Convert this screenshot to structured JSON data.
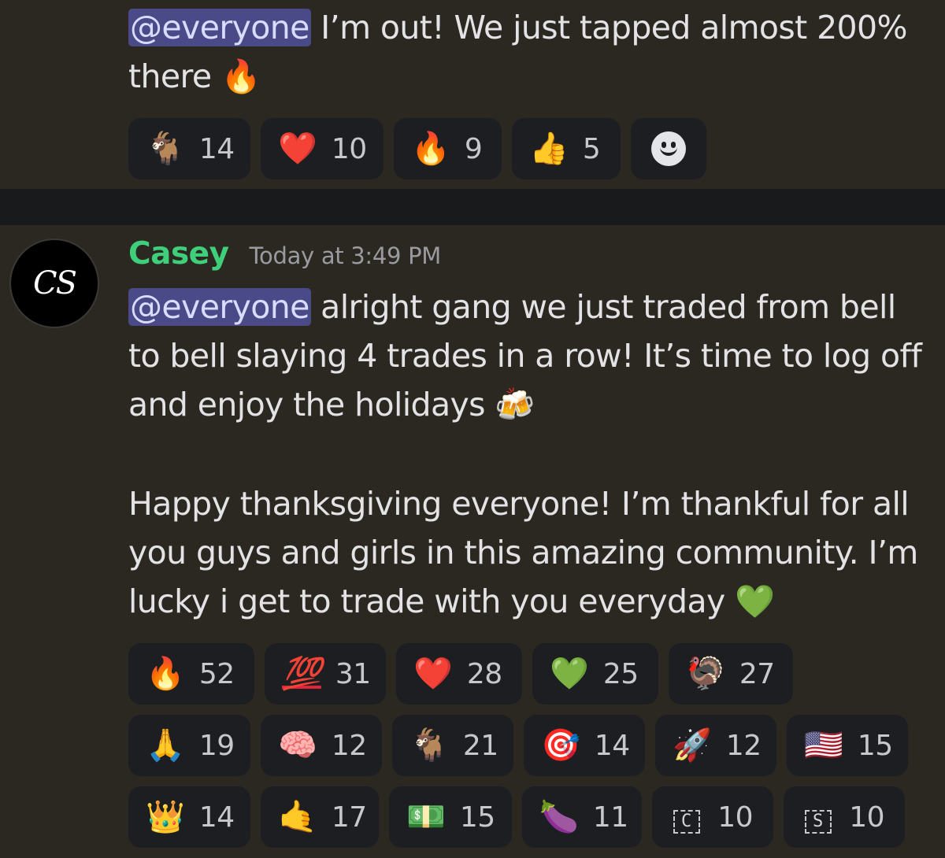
{
  "message1": {
    "mention": "@everyone",
    "text": "I’m out! We just tapped almost 200% there 🔥",
    "reactions": [
      {
        "emoji": "🐐",
        "count": "14"
      },
      {
        "emoji": "❤️",
        "count": "10"
      },
      {
        "emoji": "🔥",
        "count": "9"
      },
      {
        "emoji": "👍",
        "count": "5"
      }
    ]
  },
  "message2": {
    "avatar_initials": "CS",
    "author": "Casey",
    "timestamp": "Today at 3:49 PM",
    "mention": "@everyone",
    "paragraph1": "alright gang we just traded from bell to bell slaying 4 trades in a row! It’s time to log off and enjoy the holidays 🍻",
    "paragraph2": "Happy thanksgiving everyone! I’m thankful for all you guys and girls in this amazing community. I’m lucky i get to trade with you everyday 💚",
    "reactions_row1": [
      {
        "emoji": "🔥",
        "count": "52"
      },
      {
        "emoji": "💯",
        "count": "31"
      },
      {
        "emoji": "❤️",
        "count": "28"
      },
      {
        "emoji": "💚",
        "count": "25"
      },
      {
        "emoji": "🦃",
        "count": "27"
      }
    ],
    "reactions_row2": [
      {
        "emoji": "🙏",
        "count": "19"
      },
      {
        "emoji": "🧠",
        "count": "12"
      },
      {
        "emoji": "🐐",
        "count": "21"
      },
      {
        "emoji": "🎯",
        "count": "14"
      },
      {
        "emoji": "🚀",
        "count": "12"
      },
      {
        "emoji": "🇺🇸",
        "count": "15"
      }
    ],
    "reactions_row3": [
      {
        "emoji": "👑",
        "count": "14"
      },
      {
        "emoji": "🤙",
        "count": "17"
      },
      {
        "emoji": "💵",
        "count": "15"
      },
      {
        "emoji": "🍆",
        "count": "11"
      },
      {
        "emoji": "C",
        "count": "10"
      },
      {
        "emoji": "S",
        "count": "10"
      }
    ]
  },
  "colors": {
    "background": "#2b2822",
    "separator": "#191a1c",
    "reaction_pill": "#1d1e22",
    "mention_bg": "#4a4a88",
    "username": "#3fcf7a"
  }
}
